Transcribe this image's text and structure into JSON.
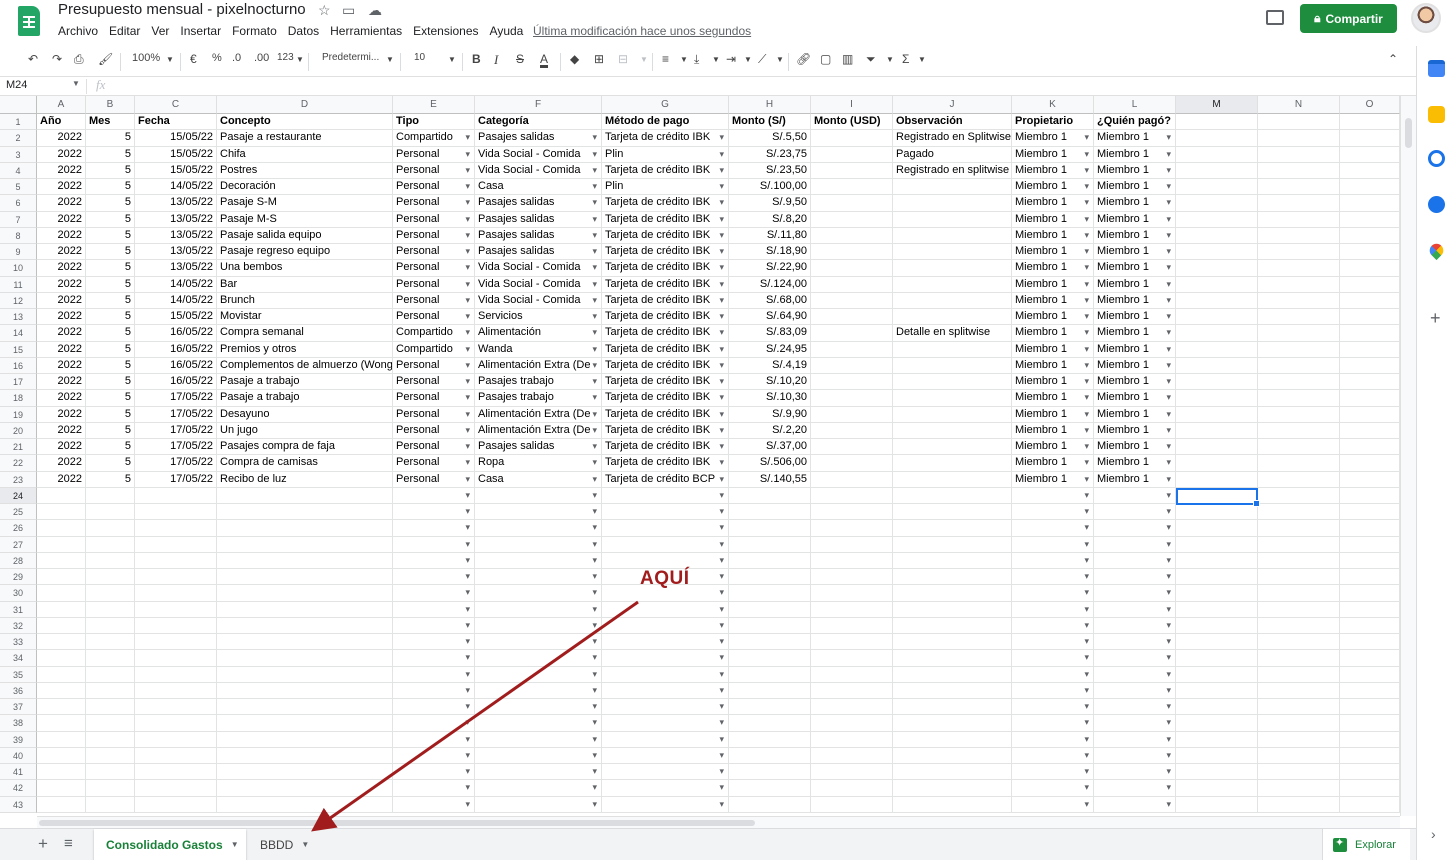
{
  "app": {
    "doc_title": "Presupuesto mensual - pixelnocturno",
    "menu": [
      "Archivo",
      "Editar",
      "Ver",
      "Insertar",
      "Formato",
      "Datos",
      "Herramientas",
      "Extensiones",
      "Ayuda"
    ],
    "last_edit": "Última modificación hace unos segundos",
    "share_label": "Compartir",
    "brand_color": "#1e8e3e"
  },
  "toolbar": {
    "zoom": "100%",
    "currency": "€",
    "percent": "%",
    "dec_less": ".0",
    "dec_more": ".00",
    "format_more": "123",
    "font": "Predetermi...",
    "font_size": "10",
    "bold": "B",
    "italic": "I",
    "strike": "S",
    "text_color": "A"
  },
  "formula_bar": {
    "name_box": "M24",
    "fx": "fx"
  },
  "columns": [
    "A",
    "B",
    "C",
    "D",
    "E",
    "F",
    "G",
    "H",
    "I",
    "J",
    "K",
    "L",
    "M",
    "N",
    "O"
  ],
  "header": [
    "Año",
    "Mes",
    "Fecha",
    "Concepto",
    "Tipo",
    "Categoría",
    "Método de pago",
    "Monto (S/)",
    "Monto (USD)",
    "Observación",
    "Propietario",
    "¿Quién pagó?"
  ],
  "rows": [
    [
      "2022",
      "5",
      "15/05/22",
      "Pasaje a restaurante",
      "Compartido",
      "Pasajes salidas",
      "Tarjeta de crédito IBK",
      "S/.5,50",
      "",
      "Registrado en Splitwise",
      "Miembro 1",
      "Miembro 1"
    ],
    [
      "2022",
      "5",
      "15/05/22",
      "Chifa",
      "Personal",
      "Vida Social - Comida",
      "Plin",
      "S/.23,75",
      "",
      "Pagado",
      "Miembro 1",
      "Miembro 1"
    ],
    [
      "2022",
      "5",
      "15/05/22",
      "Postres",
      "Personal",
      "Vida Social - Comida",
      "Tarjeta de crédito IBK",
      "S/.23,50",
      "",
      "Registrado en splitwise",
      "Miembro 1",
      "Miembro 1"
    ],
    [
      "2022",
      "5",
      "14/05/22",
      "Decoración",
      "Personal",
      "Casa",
      "Plin",
      "S/.100,00",
      "",
      "",
      "Miembro 1",
      "Miembro 1"
    ],
    [
      "2022",
      "5",
      "13/05/22",
      "Pasaje S-M",
      "Personal",
      "Pasajes salidas",
      "Tarjeta de crédito IBK",
      "S/.9,50",
      "",
      "",
      "Miembro 1",
      "Miembro 1"
    ],
    [
      "2022",
      "5",
      "13/05/22",
      "Pasaje M-S",
      "Personal",
      "Pasajes salidas",
      "Tarjeta de crédito IBK",
      "S/.8,20",
      "",
      "",
      "Miembro 1",
      "Miembro 1"
    ],
    [
      "2022",
      "5",
      "13/05/22",
      "Pasaje salida equipo",
      "Personal",
      "Pasajes salidas",
      "Tarjeta de crédito IBK",
      "S/.11,80",
      "",
      "",
      "Miembro 1",
      "Miembro 1"
    ],
    [
      "2022",
      "5",
      "13/05/22",
      "Pasaje regreso equipo",
      "Personal",
      "Pasajes salidas",
      "Tarjeta de crédito IBK",
      "S/.18,90",
      "",
      "",
      "Miembro 1",
      "Miembro 1"
    ],
    [
      "2022",
      "5",
      "13/05/22",
      "Una bembos",
      "Personal",
      "Vida Social - Comida",
      "Tarjeta de crédito IBK",
      "S/.22,90",
      "",
      "",
      "Miembro 1",
      "Miembro 1"
    ],
    [
      "2022",
      "5",
      "14/05/22",
      "Bar",
      "Personal",
      "Vida Social - Comida",
      "Tarjeta de crédito IBK",
      "S/.124,00",
      "",
      "",
      "Miembro 1",
      "Miembro 1"
    ],
    [
      "2022",
      "5",
      "14/05/22",
      "Brunch",
      "Personal",
      "Vida Social - Comida",
      "Tarjeta de crédito IBK",
      "S/.68,00",
      "",
      "",
      "Miembro 1",
      "Miembro 1"
    ],
    [
      "2022",
      "5",
      "15/05/22",
      "Movistar",
      "Personal",
      "Servicios",
      "Tarjeta de crédito IBK",
      "S/.64,90",
      "",
      "",
      "Miembro 1",
      "Miembro 1"
    ],
    [
      "2022",
      "5",
      "16/05/22",
      "Compra semanal",
      "Compartido",
      "Alimentación",
      "Tarjeta de crédito IBK",
      "S/.83,09",
      "",
      "Detalle en splitwise",
      "Miembro 1",
      "Miembro 1"
    ],
    [
      "2022",
      "5",
      "16/05/22",
      "Premios y otros",
      "Compartido",
      "Wanda",
      "Tarjeta de crédito IBK",
      "S/.24,95",
      "",
      "",
      "Miembro 1",
      "Miembro 1"
    ],
    [
      "2022",
      "5",
      "16/05/22",
      "Complementos de almuerzo (Wong)",
      "Personal",
      "Alimentación Extra (De",
      "Tarjeta de crédito IBK",
      "S/.4,19",
      "",
      "",
      "Miembro 1",
      "Miembro 1"
    ],
    [
      "2022",
      "5",
      "16/05/22",
      "Pasaje a trabajo",
      "Personal",
      "Pasajes trabajo",
      "Tarjeta de crédito IBK",
      "S/.10,20",
      "",
      "",
      "Miembro 1",
      "Miembro 1"
    ],
    [
      "2022",
      "5",
      "17/05/22",
      "Pasaje a trabajo",
      "Personal",
      "Pasajes trabajo",
      "Tarjeta de crédito IBK",
      "S/.10,30",
      "",
      "",
      "Miembro 1",
      "Miembro 1"
    ],
    [
      "2022",
      "5",
      "17/05/22",
      "Desayuno",
      "Personal",
      "Alimentación Extra (De",
      "Tarjeta de crédito IBK",
      "S/.9,90",
      "",
      "",
      "Miembro 1",
      "Miembro 1"
    ],
    [
      "2022",
      "5",
      "17/05/22",
      "Un jugo",
      "Personal",
      "Alimentación Extra (De",
      "Tarjeta de crédito IBK",
      "S/.2,20",
      "",
      "",
      "Miembro 1",
      "Miembro 1"
    ],
    [
      "2022",
      "5",
      "17/05/22",
      "Pasajes compra de faja",
      "Personal",
      "Pasajes salidas",
      "Tarjeta de crédito IBK",
      "S/.37,00",
      "",
      "",
      "Miembro 1",
      "Miembro 1"
    ],
    [
      "2022",
      "5",
      "17/05/22",
      "Compra de camisas",
      "Personal",
      "Ropa",
      "Tarjeta de crédito IBK",
      "S/.506,00",
      "",
      "",
      "Miembro 1",
      "Miembro 1"
    ],
    [
      "2022",
      "5",
      "17/05/22",
      "Recibo de luz",
      "Personal",
      "Casa",
      "Tarjeta de crédito BCP",
      "S/.140,55",
      "",
      "",
      "Miembro 1",
      "Miembro 1"
    ]
  ],
  "row_numbers": [
    "1",
    "2",
    "3",
    "4",
    "5",
    "6",
    "7",
    "8",
    "9",
    "10",
    "11",
    "12",
    "13",
    "14",
    "15",
    "16",
    "17",
    "18",
    "19",
    "20",
    "21",
    "22",
    "23",
    "24",
    "25",
    "26",
    "27",
    "28",
    "29",
    "30",
    "31",
    "32",
    "33",
    "34",
    "35",
    "36",
    "37",
    "38",
    "39",
    "40",
    "41",
    "42",
    "43"
  ],
  "sheets": [
    {
      "label": "Consolidado Gastos",
      "active": true
    },
    {
      "label": "BBDD",
      "active": false
    }
  ],
  "explore_label": "Explorar",
  "annotation": {
    "text": "AQUÍ",
    "color": "#a11d1d"
  }
}
